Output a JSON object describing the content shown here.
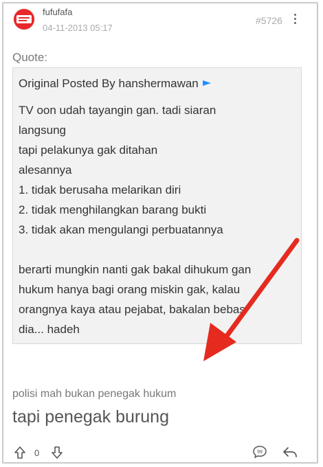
{
  "post": {
    "username": "fufufafa",
    "timestamp": "04-11-2013 05:17",
    "post_number": "#5726"
  },
  "quote": {
    "label": "Quote:",
    "author_line": "Original Posted By hanshermawan",
    "lines": [
      "TV oon udah tayangin gan. tadi siaran",
      "langsung",
      "tapi pelakunya gak ditahan",
      "alesannya",
      "1. tidak berusaha melarikan diri",
      "2. tidak menghilangkan barang bukti",
      "3. tidak akan mengulangi perbuatannya",
      "",
      "berarti mungkin nanti gak bakal dihukum gan",
      "hukum hanya bagi orang miskin gak, kalau",
      "orangnya kaya atau pejabat, bakalan bebas",
      "dia... hadeh"
    ]
  },
  "reply": {
    "small_text": "polisi mah bukan penegak hukum",
    "big_text": "tapi penegak burung"
  },
  "footer": {
    "vote_count": "0"
  },
  "colors": {
    "avatar": "#e8282b",
    "quote_bg": "#f2f2f2",
    "annotation_arrow": "#e52b1f",
    "author_flag": "#1e90ff"
  },
  "icons": [
    "more-vertical-icon",
    "author-link-icon",
    "upvote-icon",
    "downvote-icon",
    "quote-reply-icon",
    "reply-icon",
    "red-annotation-arrow"
  ]
}
